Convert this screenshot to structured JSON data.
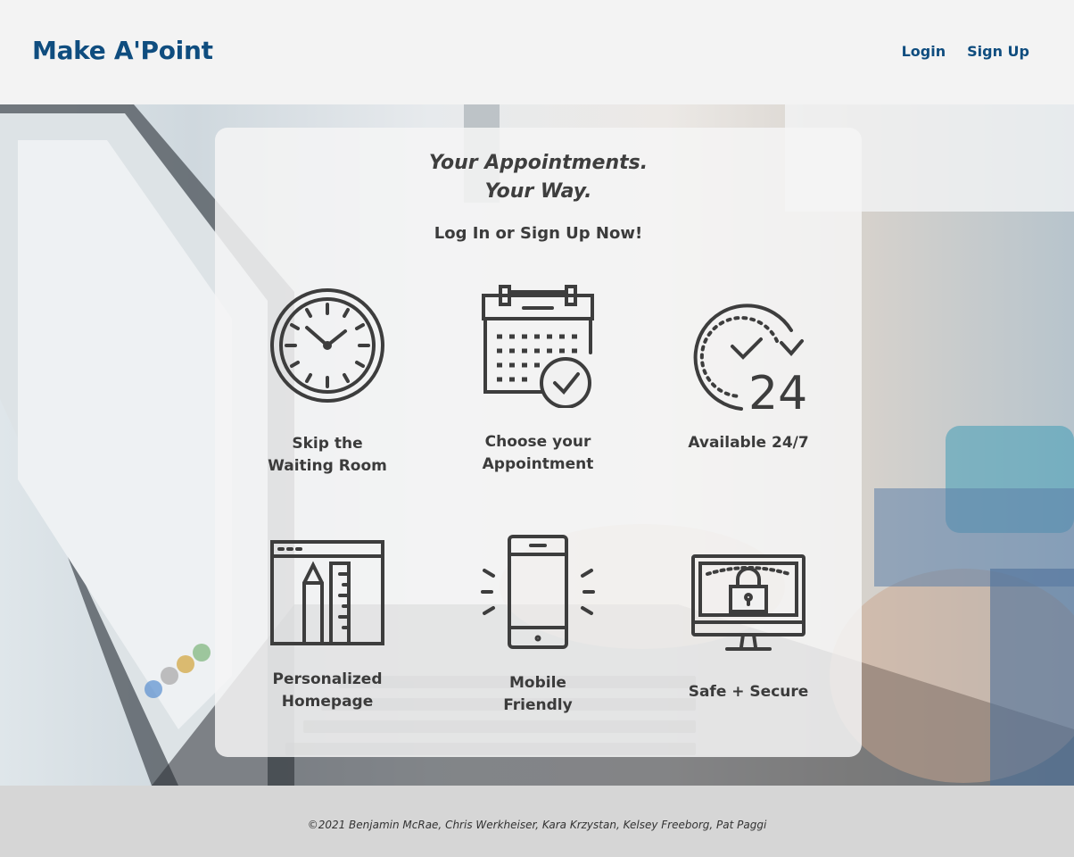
{
  "header": {
    "brand": "Make A'Point",
    "nav": {
      "login": "Login",
      "signup": "Sign Up"
    }
  },
  "hero": {
    "tagline_line1": "Your Appointments.",
    "tagline_line2": "Your Way.",
    "cta": "Log In or Sign Up Now!",
    "features": [
      {
        "icon": "clock-icon",
        "line1": "Skip the",
        "line2": "Waiting Room"
      },
      {
        "icon": "calendar-check-icon",
        "line1": "Choose your",
        "line2": "Appointment"
      },
      {
        "icon": "clock-24-icon",
        "line1": "Available 24/7",
        "line2": ""
      },
      {
        "icon": "browser-pencil-ruler-icon",
        "line1": "Personalized",
        "line2": "Homepage"
      },
      {
        "icon": "mobile-phone-icon",
        "line1": "Mobile",
        "line2": "Friendly"
      },
      {
        "icon": "monitor-lock-icon",
        "line1": "Safe + Secure",
        "line2": ""
      }
    ]
  },
  "footer": {
    "copyright": "©2021 Benjamin McRae, Chris Werkheiser, Kara Krzystan, Kelsey Freeborg, Pat Paggi"
  },
  "colors": {
    "brand": "#0f4d7f",
    "icon_stroke": "#3d3d3d",
    "footer_bg": "#d6d6d6"
  }
}
